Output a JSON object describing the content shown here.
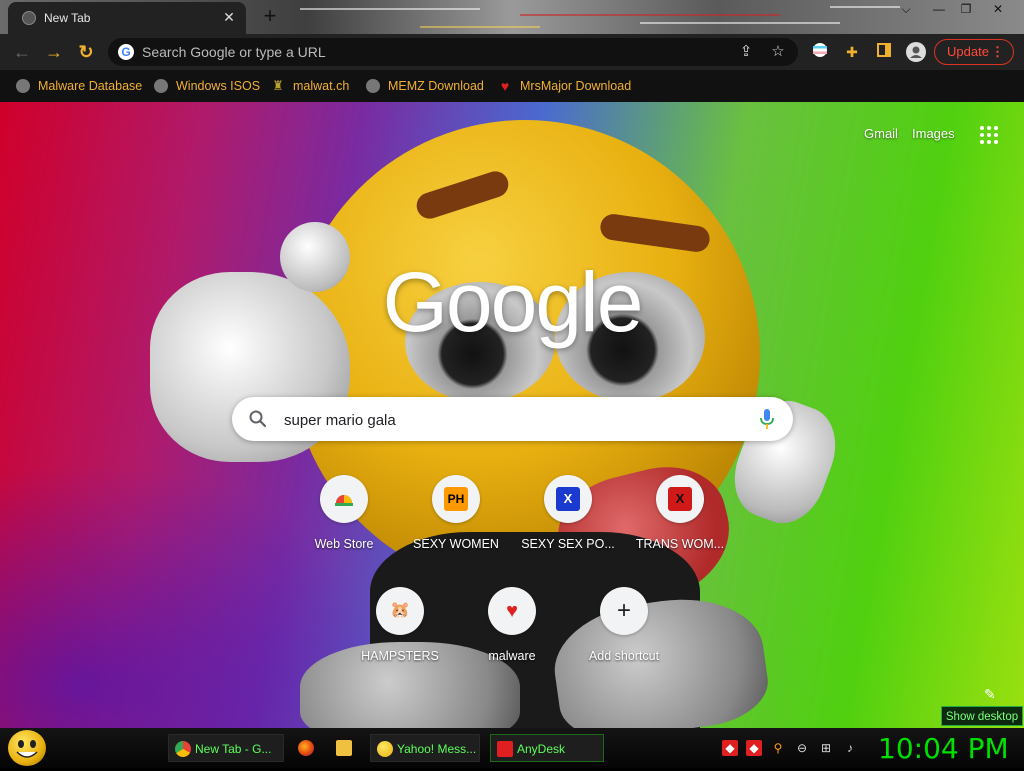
{
  "tab": {
    "title": "New Tab",
    "close_glyph": "✕"
  },
  "window_controls": {
    "minimize": "⌵",
    "min": "—",
    "restore": "❐",
    "close": "✕"
  },
  "toolbar": {
    "back_glyph": "←",
    "forward_glyph": "→",
    "reload_glyph": "↻",
    "omnibox_placeholder": "Search Google or type a URL",
    "update_label": "Update",
    "update_menu_glyph": "⋮"
  },
  "bookmarks": [
    {
      "label": "Malware Database",
      "icon": "globe-icon"
    },
    {
      "label": "Windows ISOS",
      "icon": "globe-icon"
    },
    {
      "label": "malwat.ch",
      "icon": "trophy-icon"
    },
    {
      "label": "MEMZ Download",
      "icon": "globe-icon"
    },
    {
      "label": "MrsMajor Download",
      "icon": "heart-icon"
    }
  ],
  "ntp": {
    "gmail": "Gmail",
    "images": "Images",
    "logo": "Google",
    "search_value": "super mario gala",
    "shortcuts": [
      {
        "label": "Web Store",
        "icon": "chrome-webstore-icon",
        "glyph": "◓",
        "color": "#e8443a"
      },
      {
        "label": "SEXY WOMEN",
        "icon": "ph-icon",
        "glyph": "PH",
        "color": "#f90"
      },
      {
        "label": "SEXY SEX PO...",
        "icon": "x-blue-icon",
        "glyph": "X",
        "color": "#1a3ad0"
      },
      {
        "label": "TRANS WOM...",
        "icon": "x-red-icon",
        "glyph": "X",
        "color": "#d01a1a"
      },
      {
        "label": "HAMPSTERS",
        "icon": "hamster-icon",
        "glyph": "🐹",
        "color": "#555555"
      },
      {
        "label": "malware",
        "icon": "heart-icon",
        "glyph": "♥",
        "color": "#e02020"
      },
      {
        "label": "Add shortcut",
        "icon": "plus-icon",
        "glyph": "+",
        "color": "#202124"
      }
    ],
    "show_desktop": "Show desktop"
  },
  "taskbar": {
    "tasks": [
      {
        "label": "New Tab - G...",
        "icon": "chrome-icon"
      },
      {
        "label": "",
        "icon": "firefox-icon"
      },
      {
        "label": "",
        "icon": "folder-icon"
      },
      {
        "label": "Yahoo! Mess...",
        "icon": "yahoo-messenger-icon"
      },
      {
        "label": "AnyDesk",
        "icon": "anydesk-icon"
      }
    ],
    "clock": "10:04 PM"
  },
  "colors": {
    "bookmark_text": "#f0b030",
    "update_red": "#ff4a3a",
    "taskbar_green": "#5cff5c",
    "clock_green": "#00e000"
  }
}
